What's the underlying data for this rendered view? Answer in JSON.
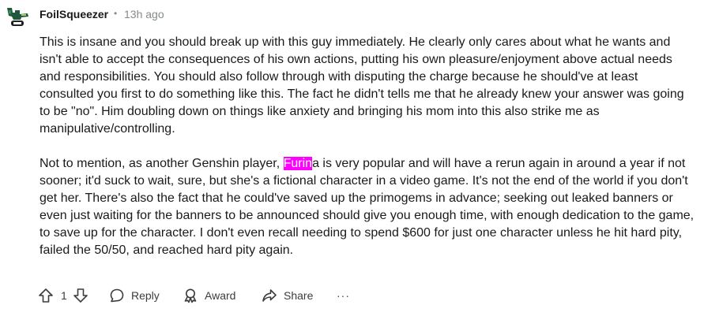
{
  "comment": {
    "username": "FoilSqueezer",
    "separator": "•",
    "timestamp": "13h ago",
    "paragraph1": "This is insane and you should break up with this guy immediately. He clearly only cares about what he wants and isn't able to accept the consequences of his own actions, putting his own pleasure/enjoyment above actual needs and responsibilities. You should also follow through with disputing the charge because he should've at least consulted you first to do something like this. The fact he didn't tells me that he already knew your answer was going to be \"no\". Him doubling down on things like anxiety and bringing his mom into this also strike me as manipulative/controlling.",
    "paragraph2_before": "Not to mention, as another Genshin player, ",
    "paragraph2_highlight": "Furin",
    "paragraph2_after": "a is very popular and will have a rerun again in around a year if not sooner; it'd suck to wait, sure, but she's a fictional character in a video game. It's not the end of the world if you don't get her. There's also the fact that he could've saved up the primogems in advance; seeking out leaked banners or even just waiting for the banners to be announced should give you enough time, with enough dedication to the game, to save up for the character. I don't even recall needing to spend $600 for just one character unless he hit hard pity, failed the 50/50, and reached hard pity again.",
    "highlight_color": "#ff00ff"
  },
  "actions": {
    "vote_count": "1",
    "reply_label": "Reply",
    "award_label": "Award",
    "share_label": "Share",
    "more_label": "···",
    "upvote_icon": "upvote-arrow-icon",
    "downvote_icon": "downvote-arrow-icon",
    "reply_icon": "speech-bubble-icon",
    "award_icon": "award-ribbon-icon",
    "share_icon": "share-arrow-icon"
  }
}
